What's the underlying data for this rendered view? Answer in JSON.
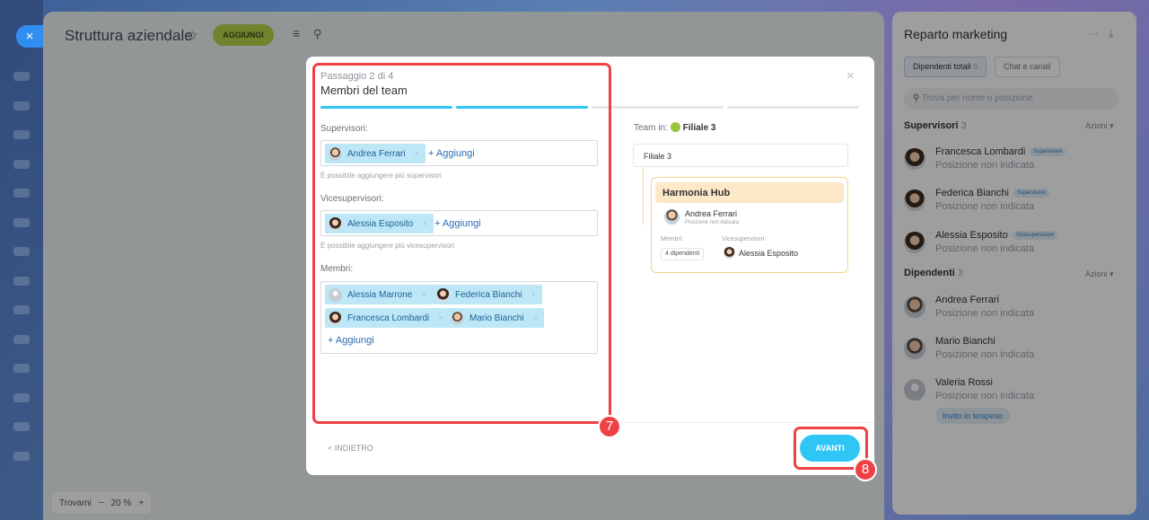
{
  "app": {
    "close_label": "×",
    "title": "Struttura aziendale",
    "add_button": "AGGIUNGI",
    "menu_icon": "≡",
    "search_icon": "⚲",
    "pin_icon": "✩"
  },
  "zoom": {
    "find_label": "Trovami",
    "minus": "−",
    "level": "20 %",
    "plus": "+"
  },
  "modal": {
    "step_label": "Passaggio 2 di 4",
    "step_title": "Membri del team",
    "close_label": "×",
    "progress": {
      "total_steps": 4,
      "current_step": 2
    },
    "supervisors": {
      "label": "Supervisori:",
      "tags": [
        {
          "name": "Andrea Ferrari"
        }
      ],
      "add_label": "+ Aggiungi",
      "hint": "È possibile aggiungere più supervisori"
    },
    "vice": {
      "label": "Vicesupervisori:",
      "tags": [
        {
          "name": "Alessia Esposito"
        }
      ],
      "add_label": "+ Aggiungi",
      "hint": "È possibile aggiungere più vicesupervisori"
    },
    "members": {
      "label": "Membri:",
      "tags": [
        {
          "name": "Alessia Marrone"
        },
        {
          "name": "Federica Bianchi"
        },
        {
          "name": "Francesca Lombardi"
        },
        {
          "name": "Mario Bianchi"
        }
      ],
      "add_label": "+ Aggiungi"
    },
    "remove_label": "×",
    "back_label": "< INDIETRO",
    "next_label": "AVANTI",
    "preview": {
      "team_in_label": "Team in:",
      "team_in_value": "Filiale 3",
      "parent": "Filiale 3",
      "card_title": "Harmonia Hub",
      "head_name": "Andrea Ferrari",
      "head_sub": "Posizione non indicata",
      "members_label": "Membri:",
      "members_count": "4 dipendenti",
      "vice_label": "Vicesupervisori:",
      "vice_name": "Alessia Esposito"
    }
  },
  "markers": {
    "m1": "7",
    "m2": "8"
  },
  "right_panel": {
    "title": "Reparto marketing",
    "more_icon": "···",
    "collapse_icon": "⤓",
    "tabs": {
      "employees": "Dipendenti totali",
      "employees_count": "6",
      "chats": "Chat e canali"
    },
    "search_placeholder": "Trova per nome o posizione",
    "supervisors_title": "Supervisori",
    "supervisors_count": "3",
    "actions_label": "Azioni",
    "supervisors": [
      {
        "name": "Francesca Lombardi",
        "badge": "Supervisore",
        "sub": "Posizione non indicata"
      },
      {
        "name": "Federica Bianchi",
        "badge": "Supervisore",
        "sub": "Posizione non indicata"
      },
      {
        "name": "Alessia Esposito",
        "badge": "Vicesupervisore",
        "sub": "Posizione non indicata"
      }
    ],
    "employees_title": "Dipendenti",
    "employees_count": "3",
    "employees": [
      {
        "name": "Andrea Ferrari",
        "sub": "Posizione non indicata"
      },
      {
        "name": "Mario Bianchi",
        "sub": "Posizione non indicata"
      },
      {
        "name": "Valeria Rossi",
        "sub": "Posizione non indicata"
      }
    ],
    "pending_label": "Invito in sospeso"
  },
  "colors": {
    "accent": "#2fc6f6",
    "highlight": "#ef4145",
    "add_button": "#b7d54a"
  }
}
